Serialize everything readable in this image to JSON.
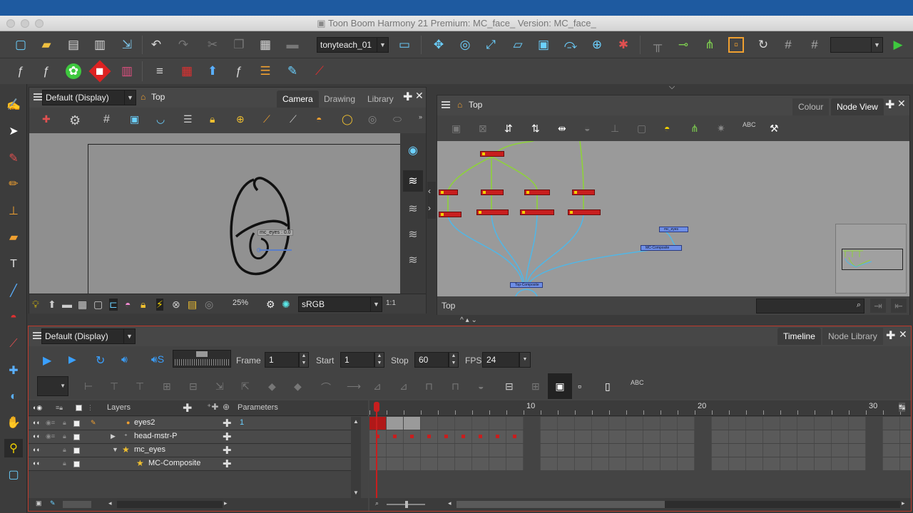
{
  "app": {
    "title": "Toon Boom Harmony 21 Premium: MC_face_ Version: MC_face_"
  },
  "toolbar": {
    "workspace_dropdown": "tonyteach_01"
  },
  "camera_view": {
    "display": "Default (Display)",
    "breadcrumb": "Top",
    "tabs": [
      "Camera",
      "Drawing",
      "Library"
    ],
    "active_tab": "Camera",
    "zoom": "25%",
    "color_space": "sRGB",
    "ratio": "1:1",
    "drawing_label": "mc_eyes : 0.0"
  },
  "node_view": {
    "breadcrumb": "Top",
    "tabs": [
      "Colour",
      "Node View"
    ],
    "active_tab": "Node View",
    "footer_label": "Top",
    "nodes": {
      "composite": "MC-Composite",
      "eyes_node": "mc_eyes",
      "bottom": "Top-Composite"
    }
  },
  "timeline": {
    "display": "Default (Display)",
    "tabs": [
      "Timeline",
      "Node Library"
    ],
    "active_tab": "Timeline",
    "frame_label": "Frame",
    "frame_value": "1",
    "start_label": "Start",
    "start_value": "1",
    "stop_label": "Stop",
    "stop_value": "60",
    "fps_label": "FPS",
    "fps_value": "24",
    "layers_header": "Layers",
    "parameters_header": "Parameters",
    "ruler": [
      "10",
      "20",
      "30"
    ],
    "current_frame": 1,
    "layers": [
      {
        "name": "eyes2",
        "param": "1"
      },
      {
        "name": "head-mstr-P",
        "param": ""
      },
      {
        "name": "mc_eyes",
        "param": ""
      },
      {
        "name": "MC-Composite",
        "param": ""
      }
    ]
  },
  "colors": {
    "accent_red": "#c81e1e",
    "node_wire_green": "#8ed23a",
    "node_wire_blue": "#4fb7e8",
    "selection_red": "#c0392b"
  }
}
